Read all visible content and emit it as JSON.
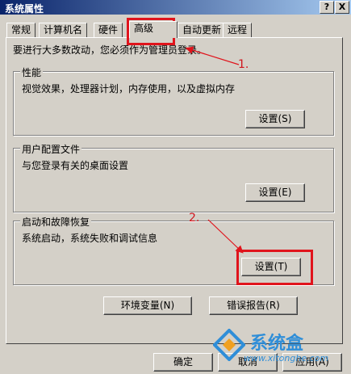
{
  "window": {
    "title": "系统属性",
    "help_label": "?",
    "close_label": "X"
  },
  "tabs": [
    {
      "label": "常规"
    },
    {
      "label": "计算机名"
    },
    {
      "label": "硬件"
    },
    {
      "label": "高级"
    },
    {
      "label": "自动更新"
    },
    {
      "label": "远程"
    }
  ],
  "active_tab": "高级",
  "notice": "要进行大多数改动，您必须作为管理员登录。",
  "groups": {
    "performance": {
      "title": "性能",
      "desc": "视觉效果，处理器计划，内存使用，以及虚拟内存",
      "button": "设置(S)"
    },
    "profile": {
      "title": "用户配置文件",
      "desc": "与您登录有关的桌面设置",
      "button": "设置(E)"
    },
    "startup": {
      "title": "启动和故障恢复",
      "desc": "系统启动，系统失败和调试信息",
      "button": "设置(T)"
    }
  },
  "bottom_buttons": {
    "env": "环境变量(N)",
    "error": "错误报告(R)"
  },
  "dialog_buttons": {
    "ok": "确定",
    "cancel": "取消",
    "apply": "应用(A)"
  },
  "annotations": {
    "step1": "1.",
    "step2": "2."
  },
  "watermark": {
    "text": "系统盒",
    "url": "www.xitonghe.com"
  },
  "colors": {
    "highlight": "#e0141c",
    "title_bar": "#0a246a",
    "watermark": "#2f8ed8"
  }
}
